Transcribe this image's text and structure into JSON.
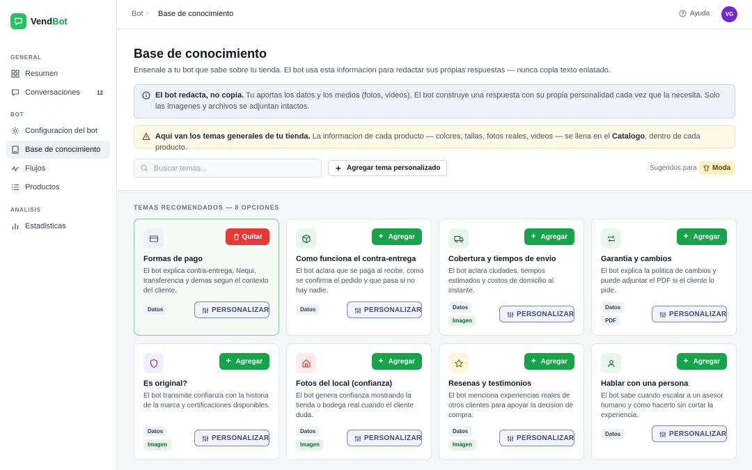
{
  "brand": {
    "name_main": "Vend",
    "name_accent": "Bot"
  },
  "sidebar": {
    "sections": [
      {
        "label": "GENERAL"
      },
      {
        "label": "BOT"
      },
      {
        "label": "ANALISIS"
      }
    ],
    "items": [
      {
        "label": "Resumen",
        "icon": "grid-icon"
      },
      {
        "label": "Conversaciones",
        "icon": "chat-icon",
        "count": "12"
      },
      {
        "label": "Configuracion del bot",
        "icon": "gear-icon"
      },
      {
        "label": "Base de conocimiento",
        "icon": "book-icon",
        "active": true
      },
      {
        "label": "Flujos",
        "icon": "pulse-icon"
      },
      {
        "label": "Productos",
        "icon": "list-icon"
      },
      {
        "label": "Estadisticas",
        "icon": "bar-chart-icon"
      }
    ]
  },
  "topbar": {
    "breadcrumb": [
      "Bot",
      "Base de conocimiento"
    ],
    "help_label": "Ayuda",
    "avatar_initials": "VG"
  },
  "page": {
    "title": "Base de conocimiento",
    "subtitle": "Ensenale a tu bot que sabe sobre tu tienda. El bot usa esta informacion para redactar sus propias respuestas — nunca copia texto enlatado."
  },
  "notes": {
    "info_bold": "El bot redacta, no copia.",
    "info_text": " Tu aportas los datos y los medios (fotos, videos). El bot construye una respuesta con su propia personalidad cada vez que la necesita. Solo las imagenes y archivos se adjuntan intactos.",
    "warn_bold": "Aqui van los temas generales de tu tienda.",
    "warn_text_1": " La informacion de cada producto — colores, tallas, fotos reales, videos — se llena en el ",
    "warn_link": "Catalogo",
    "warn_text_2": ", dentro de cada producto."
  },
  "toolbar": {
    "search_placeholder": "Buscar temas...",
    "add_custom_label": "Agregar tema personalizado",
    "suggested_label": "Sugeridos para",
    "suggested_tag": "Moda"
  },
  "section_label": "TEMAS RECOMENDADOS — 8 OPCIONES",
  "cards": [
    {
      "title": "Formas de pago",
      "desc": "El bot explica contra-entrega, Nequi, transferencia y demas segun el contexto del cliente.",
      "action": "Quitar",
      "chips": [
        "Datos"
      ],
      "icon": "credit-card-icon",
      "selected": true
    },
    {
      "title": "Como funciona el contra-entrega",
      "desc": "El bot aclara que se paga al recibir, como se confirma el pedido y que pasa si no hay nadie.",
      "action": "Agregar",
      "chips": [
        "Datos"
      ],
      "icon": "package-icon"
    },
    {
      "title": "Cobertura y tiempos de envio",
      "desc": "El bot aclara ciudades, tiempos estimados y costos de domicilio al instante.",
      "action": "Agregar",
      "chips": [
        "Datos",
        "Imagen"
      ],
      "icon": "truck-icon"
    },
    {
      "title": "Garantia y cambios",
      "desc": "El bot explica la politica de cambios y puede adjuntar el PDF si el cliente lo pide.",
      "action": "Agregar",
      "chips": [
        "Datos",
        "PDF"
      ],
      "icon": "exchange-icon"
    },
    {
      "title": "Es original?",
      "desc": "El bot transmite confianza con la historia de la marca y certificaciones disponibles.",
      "action": "Agregar",
      "chips": [
        "Datos",
        "Imagen"
      ],
      "icon": "shield-icon"
    },
    {
      "title": "Fotos del local (confianza)",
      "desc": "El bot genera confianza mostrando la tienda o bodega real cuando el cliente duda.",
      "action": "Agregar",
      "chips": [
        "Datos",
        "Imagen"
      ],
      "icon": "store-icon"
    },
    {
      "title": "Resenas y testimonios",
      "desc": "El bot menciona experiencias reales de otros clientes para apoyar la decision de compra.",
      "action": "Agregar",
      "chips": [
        "Datos",
        "Imagen"
      ],
      "icon": "star-icon"
    },
    {
      "title": "Hablar con una persona",
      "desc": "El bot sabe cuando escalar a un asesor humano y como hacerlo sin cortar la experiencia.",
      "action": "Agregar",
      "chips": [
        "Datos"
      ],
      "icon": "person-icon"
    }
  ],
  "personalize_label": "PERSONALIZAR",
  "colors": {
    "accent": "#16a34a",
    "danger": "#e53935",
    "avatar": "#6d28d9",
    "personalize_border": "#7c86b8"
  }
}
